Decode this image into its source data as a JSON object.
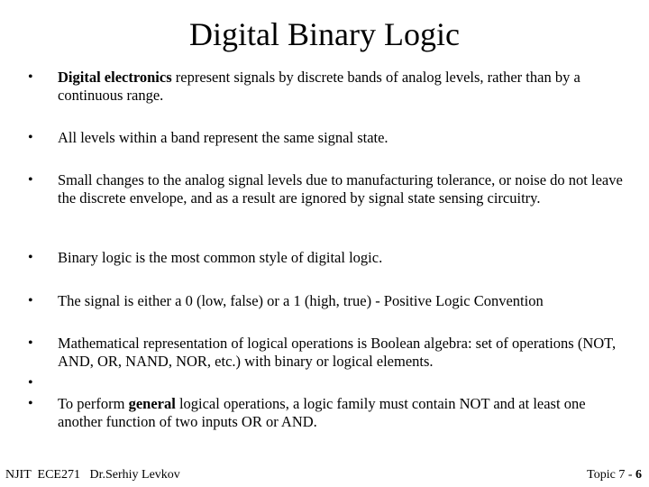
{
  "slide": {
    "title": "Digital Binary Logic",
    "bullets": [
      {
        "bold": "Digital electronics",
        "text": " represent signals by discrete bands of analog levels, rather than by a continuous range."
      },
      {
        "text": "All levels within a band represent the same signal state."
      },
      {
        "text": "Small changes to the analog signal levels due to manufacturing tolerance, or noise do not leave the discrete envelope, and as a result are ignored by signal state sensing circuitry."
      },
      {
        "text": "Binary logic is the most common style of digital logic."
      },
      {
        "text": "The signal is either a 0 (low, false) or a 1 (high, true) - Positive Logic Convention"
      },
      {
        "text": "Mathematical representation of logical operations is Boolean algebra: set of operations (NOT, AND, OR, NAND, NOR, etc.) with binary or logical elements."
      },
      {
        "text": ""
      },
      {
        "pre": "To perform ",
        "bold": "general",
        "text": " logical operations, a logic family must contain NOT and at least one another function of two inputs OR or AND."
      }
    ],
    "bullet_glyph": "•"
  },
  "footer": {
    "left": "NJIT  ECE271   Dr.Serhiy Levkov",
    "topic_label": "Topic 7 - ",
    "page_number": "6"
  }
}
